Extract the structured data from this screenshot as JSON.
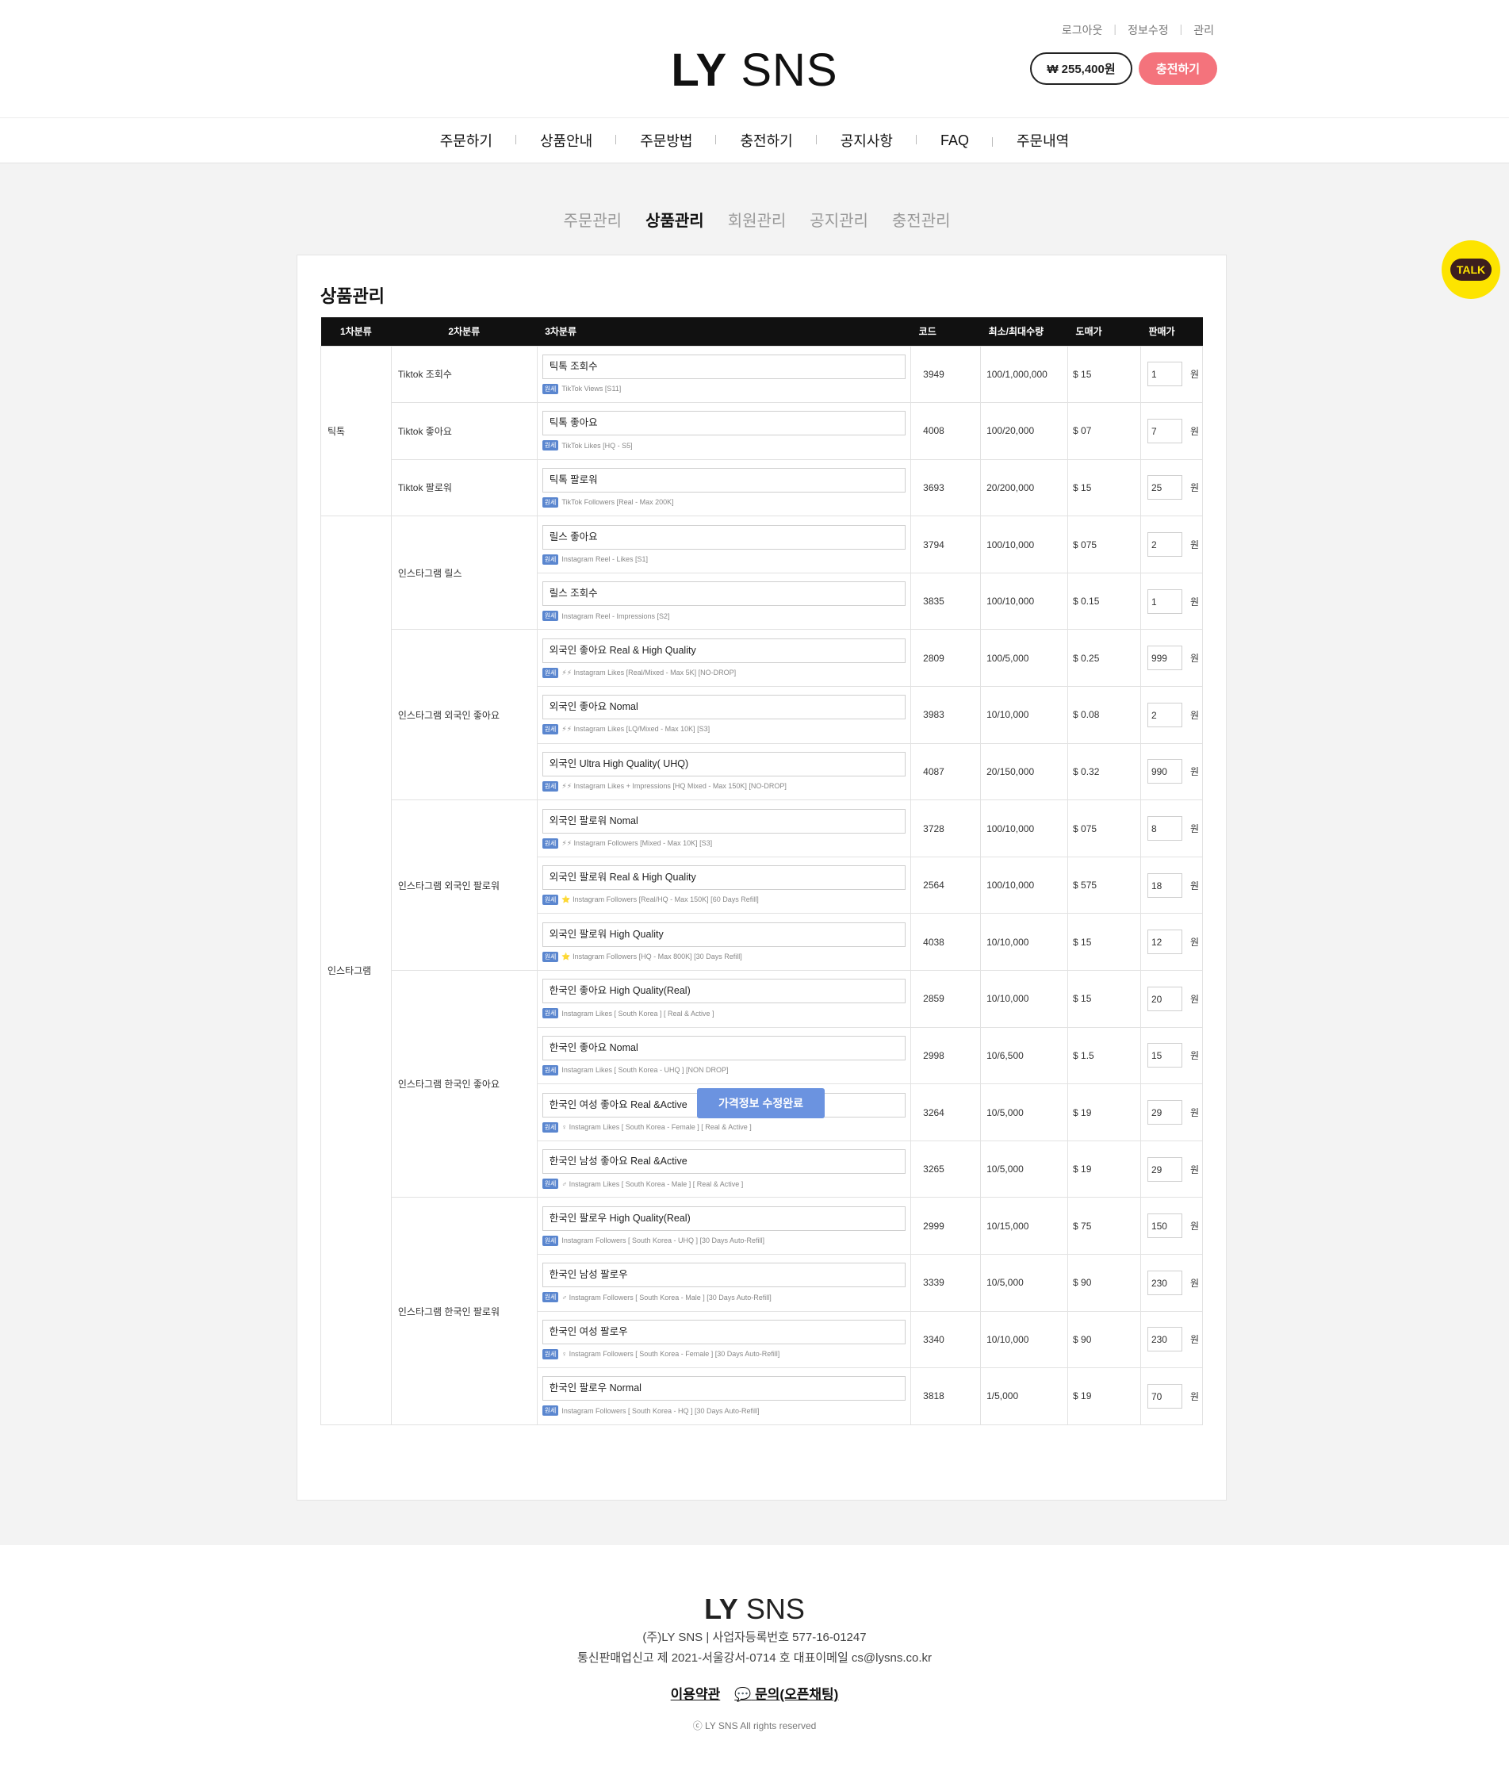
{
  "header": {
    "links": [
      "로그아웃",
      "정보수정",
      "관리"
    ],
    "logo_bold": "LY",
    "logo_light": "SNS",
    "balance": "₩ 255,400원",
    "charge": "충전하기"
  },
  "nav": [
    "주문하기",
    "상품안내",
    "주문방법",
    "충전하기",
    "공지사항",
    "FAQ",
    "주문내역"
  ],
  "subnav": [
    "주문관리",
    "상품관리",
    "회원관리",
    "공지관리",
    "충전관리"
  ],
  "panel": {
    "title": "상품관리"
  },
  "table": {
    "headers": [
      "1차분류",
      "2차분류",
      "3차분류",
      "코드",
      "최소/최대수량",
      "도매가",
      "판매가"
    ],
    "won": "원",
    "badge": "원세",
    "groups": [
      {
        "cat1": "틱톡",
        "subs": [
          {
            "cat2": "Tiktok 조회수",
            "rows": [
              {
                "name": "틱톡 조회수",
                "detail": "TikTok Views [S11]",
                "code": "3949",
                "qty": "100/1,000,000",
                "whole": "$ 15",
                "price": "1"
              }
            ]
          },
          {
            "cat2": "Tiktok 좋아요",
            "rows": [
              {
                "name": "틱톡 좋아요",
                "detail": "TikTok Likes [HQ - S5]",
                "code": "4008",
                "qty": "100/20,000",
                "whole": "$ 07",
                "price": "7"
              }
            ]
          },
          {
            "cat2": "Tiktok 팔로워",
            "rows": [
              {
                "name": "틱톡 팔로워",
                "detail": "TikTok Followers [Real - Max 200K]",
                "code": "3693",
                "qty": "20/200,000",
                "whole": "$ 15",
                "price": "25"
              }
            ]
          }
        ]
      },
      {
        "cat1": "인스타그램",
        "subs": [
          {
            "cat2": "인스타그램 릴스",
            "rows": [
              {
                "name": "릴스 좋아요",
                "detail": "Instagram Reel - Likes [S1]",
                "code": "3794",
                "qty": "100/10,000",
                "whole": "$ 075",
                "price": "2"
              },
              {
                "name": "릴스 조회수",
                "detail": "Instagram Reel - Impressions [S2]",
                "code": "3835",
                "qty": "100/10,000",
                "whole": "$ 0.15",
                "price": "1"
              }
            ]
          },
          {
            "cat2": "인스타그램 외국인 좋아요",
            "rows": [
              {
                "name": "외국인 좋아요 Real & High Quality",
                "detail": "⚡⚡ Instagram Likes [Real/Mixed - Max 5K] [NO-DROP]",
                "code": "2809",
                "qty": "100/5,000",
                "whole": "$ 0.25",
                "price": "999"
              },
              {
                "name": "외국인 좋아요 Nomal",
                "detail": "⚡⚡ Instagram Likes [LQ/Mixed - Max 10K] [S3]",
                "code": "3983",
                "qty": "10/10,000",
                "whole": "$ 0.08",
                "price": "2"
              },
              {
                "name": "외국인 Ultra High Quality( UHQ)",
                "detail": "⚡⚡ Instagram Likes + Impressions [HQ Mixed - Max 150K] [NO-DROP]",
                "code": "4087",
                "qty": "20/150,000",
                "whole": "$ 0.32",
                "price": "990"
              }
            ]
          },
          {
            "cat2": "인스타그램 외국인 팔로워",
            "rows": [
              {
                "name": "외국인 팔로워 Nomal",
                "detail": "⚡⚡ Instagram Followers [Mixed - Max 10K] [S3]",
                "code": "3728",
                "qty": "100/10,000",
                "whole": "$ 075",
                "price": "8"
              },
              {
                "name": "외국인 팔로워 Real & High Quality",
                "detail": "⭐ Instagram Followers [Real/HQ - Max 150K] [60 Days Refill]",
                "code": "2564",
                "qty": "100/10,000",
                "whole": "$ 575",
                "price": "18"
              },
              {
                "name": "외국인 팔로워 High Quality",
                "detail": "⭐ Instagram Followers [HQ - Max 800K] [30 Days Refill]",
                "code": "4038",
                "qty": "10/10,000",
                "whole": "$ 15",
                "price": "12"
              }
            ]
          },
          {
            "cat2": "인스타그램 한국인 좋아요",
            "rows": [
              {
                "name": "한국인 좋아요  High Quality(Real)",
                "detail": "Instagram Likes [ South Korea ] [ Real & Active ]",
                "code": "2859",
                "qty": "10/10,000",
                "whole": "$ 15",
                "price": "20"
              },
              {
                "name": "한국인 좋아요 Nomal",
                "detail": "Instagram Likes [ South Korea - UHQ ] [NON DROP]",
                "code": "2998",
                "qty": "10/6,500",
                "whole": "$ 1.5",
                "price": "15"
              },
              {
                "name": "한국인 여성 좋아요 Real &Active",
                "detail": "♀ Instagram Likes [ South Korea - Female ] [ Real & Active ]",
                "code": "3264",
                "qty": "10/5,000",
                "whole": "$ 19",
                "price": "29"
              },
              {
                "name": "한국인 남성 좋아요 Real &Active",
                "detail": "♂ Instagram Likes [ South Korea - Male ] [ Real & Active ]",
                "code": "3265",
                "qty": "10/5,000",
                "whole": "$ 19",
                "price": "29"
              }
            ]
          },
          {
            "cat2": "인스타그램 한국인 팔로워",
            "rows": [
              {
                "name": "한국인 팔로우 High Quality(Real)",
                "detail": "Instagram Followers [ South Korea - UHQ ] [30 Days Auto-Refill]",
                "code": "2999",
                "qty": "10/15,000",
                "whole": "$ 75",
                "price": "150"
              },
              {
                "name": "한국인 남성 팔로우",
                "detail": "♂ Instagram Followers [ South Korea - Male ] [30 Days Auto-Refill]",
                "code": "3339",
                "qty": "10/5,000",
                "whole": "$ 90",
                "price": "230"
              },
              {
                "name": "한국인 여성 팔로우",
                "detail": "♀ Instagram Followers [ South Korea - Female ] [30 Days Auto-Refill]",
                "code": "3340",
                "qty": "10/10,000",
                "whole": "$ 90",
                "price": "230"
              },
              {
                "name": "한국인 팔로우 Normal",
                "detail": "Instagram Followers [ South Korea - HQ ] [30 Days Auto-Refill]",
                "code": "3818",
                "qty": "1/5,000",
                "whole": "$ 19",
                "price": "70"
              }
            ]
          }
        ]
      }
    ]
  },
  "save_button": "가격정보 수정완료",
  "talk": "TALK",
  "footer": {
    "logo_bold": "LY",
    "logo_light": "SNS",
    "line1": "(주)LY SNS | 사업자등록번호 577-16-01247",
    "line2": "통신판매업신고 제 2021-서울강서-0714 호 대표이메일 cs@lysns.co.kr",
    "terms": "이용약관",
    "inquiry": "문의(오픈채팅)",
    "copyright": "ⓒ LY SNS All rights reserved"
  }
}
